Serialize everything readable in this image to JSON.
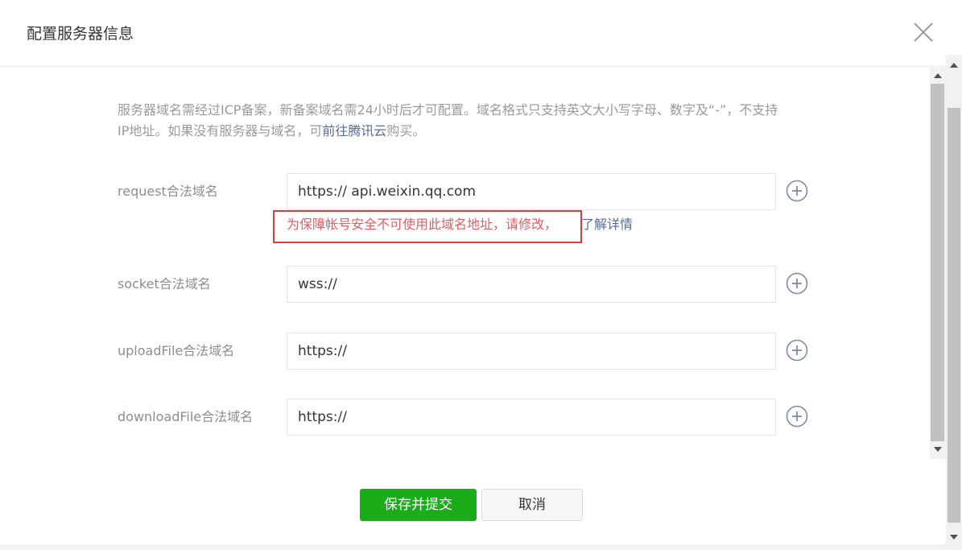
{
  "dialog": {
    "title": "配置服务器信息"
  },
  "description": {
    "text": "服务器域名需经过ICP备案，新备案域名需24小时后才可配置。域名格式只支持英文大小写字母、数字及“-”，不支持IP地址。如果没有服务器与域名，可",
    "link": "前往腾讯云",
    "suffix": "购买。"
  },
  "fields": [
    {
      "label": "request合法域名",
      "value": "https:// api.weixin.qq.com"
    },
    {
      "label": "socket合法域名",
      "value": "wss://"
    },
    {
      "label": "uploadFile合法域名",
      "value": "https://"
    },
    {
      "label": "downloadFile合法域名",
      "value": "https://"
    }
  ],
  "error": {
    "message": "为保障帐号安全不可使用此域名地址，请修改，",
    "link": "了解详情",
    "color": "#e0393e"
  },
  "buttons": {
    "submit": "保存并提交",
    "cancel": "取消"
  },
  "colors": {
    "primary": "#1aad19",
    "link": "#576b95"
  }
}
